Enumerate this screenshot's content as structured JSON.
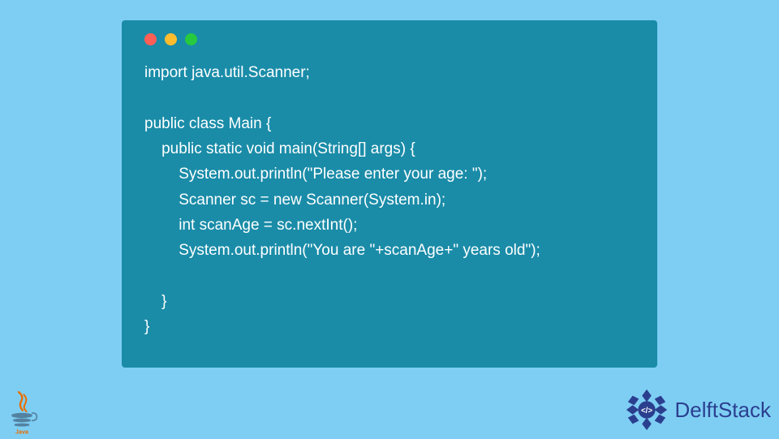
{
  "code": {
    "lines": [
      "import java.util.Scanner;",
      "",
      "public class Main {",
      "    public static void main(String[] args) {",
      "        System.out.println(\"Please enter your age: \");",
      "        Scanner sc = new Scanner(System.in);",
      "        int scanAge = sc.nextInt();",
      "        System.out.println(\"You are \"+scanAge+\" years old\");",
      "",
      "    }",
      "}"
    ]
  },
  "branding": {
    "java_label": "Java",
    "delft_label": "DelftStack"
  },
  "colors": {
    "page_bg": "#7ecef4",
    "window_bg": "#1a8ca8",
    "code_text": "#ffffff",
    "delft_blue": "#2b3f8f"
  }
}
